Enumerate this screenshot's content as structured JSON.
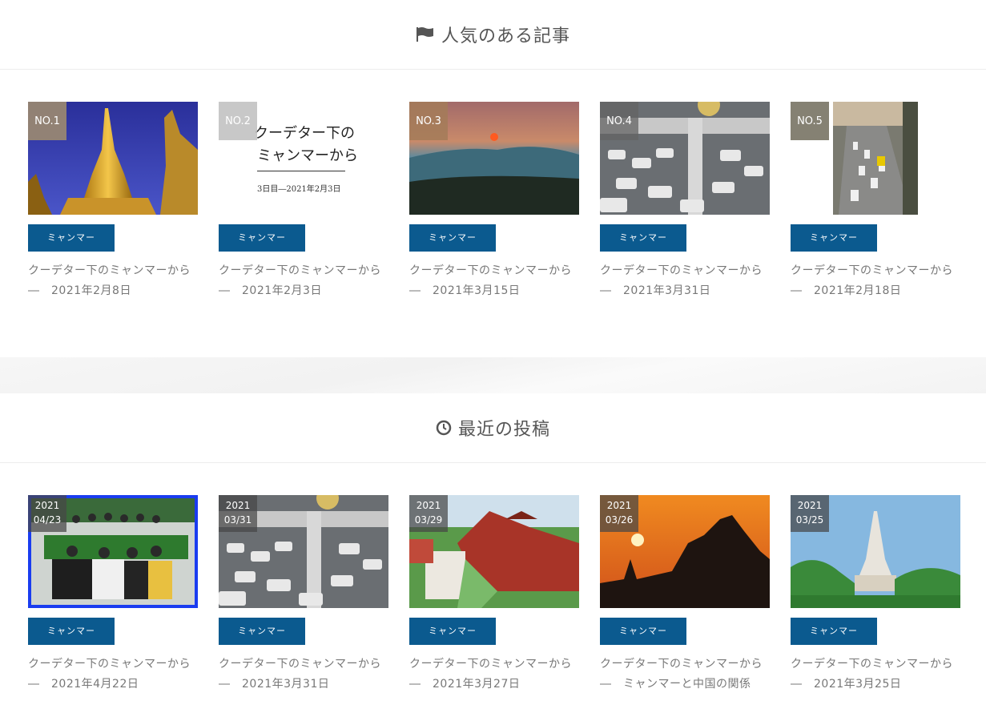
{
  "popular": {
    "heading": "人気のある記事",
    "heading_icon": "flag-icon",
    "cards": [
      {
        "rank": "NO.1",
        "category": "ミャンマー",
        "title": "クーデター下のミャンマーから　―　2021年2月8日",
        "image": "golden-pagoda-night"
      },
      {
        "rank": "NO.2",
        "category": "ミャンマー",
        "title": "クーデター下のミャンマーから　―　2021年2月3日",
        "image": "title-card",
        "thumb_title_line1": "クーデター下の",
        "thumb_title_line2": "ミャンマーから",
        "thumb_subtitle": "3日目―2021年2月3日"
      },
      {
        "rank": "NO.3",
        "category": "ミャンマー",
        "title": "クーデター下のミャンマーから　―　2021年3月15日",
        "image": "sunset-landscape"
      },
      {
        "rank": "NO.4",
        "category": "ミャンマー",
        "title": "クーデター下のミャンマーから　―　2021年3月31日",
        "image": "traffic-bridge"
      },
      {
        "rank": "NO.5",
        "category": "ミャンマー",
        "title": "クーデター下のミャンマーから　―　2021年2月18日",
        "image": "busy-street"
      }
    ]
  },
  "recent": {
    "heading": "最近の投稿",
    "heading_icon": "clock-icon",
    "cards": [
      {
        "year": "2021",
        "md": "04/23",
        "category": "ミャンマー",
        "title": "クーデター下のミャンマーから　―　2021年4月22日",
        "image": "group-photo"
      },
      {
        "year": "2021",
        "md": "03/31",
        "category": "ミャンマー",
        "title": "クーデター下のミャンマーから　―　2021年3月31日",
        "image": "traffic-bridge"
      },
      {
        "year": "2021",
        "md": "03/29",
        "category": "ミャンマー",
        "title": "クーデター下のミャンマーから　―　2021年3月27日",
        "image": "palace"
      },
      {
        "year": "2021",
        "md": "03/26",
        "category": "ミャンマー",
        "title": "クーデター下のミャンマーから　―　ミャンマーと中国の関係",
        "image": "temple-sunset"
      },
      {
        "year": "2021",
        "md": "03/25",
        "category": "ミャンマー",
        "title": "クーデター下のミャンマーから　―　2021年3月25日",
        "image": "white-pagoda"
      }
    ]
  },
  "colors": {
    "category_bg": "#0b5a8f",
    "rank_badge": "#a38f6c",
    "date_badge": "#464646"
  }
}
